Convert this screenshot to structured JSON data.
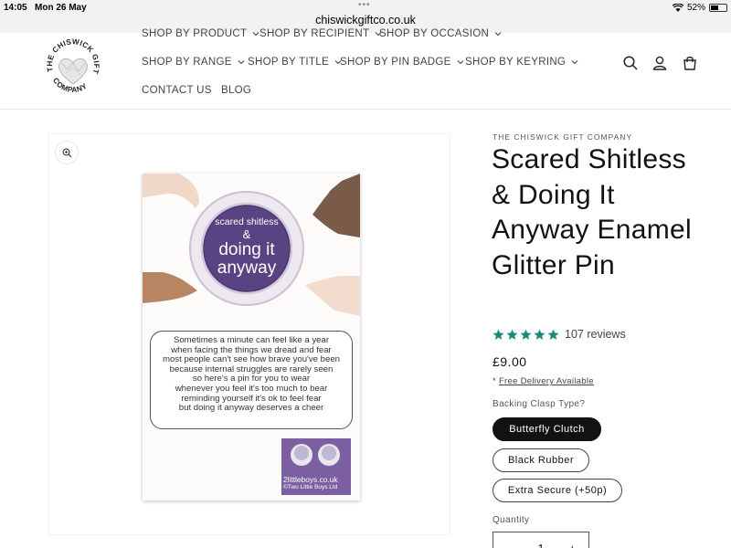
{
  "status_bar": {
    "time": "14:05",
    "date": "Mon 26 May",
    "dots": "•••",
    "url": "chiswickgiftco.co.uk",
    "battery": "52%",
    "battery_level": 0.52
  },
  "header": {
    "logo_text": "THE CHISWICK GIFT COMPANY",
    "nav": [
      {
        "label": "SHOP BY PRODUCT"
      },
      {
        "label": "SHOP BY RECIPIENT"
      },
      {
        "label": "SHOP BY OCCASION"
      },
      {
        "label": "SHOP BY RANGE"
      },
      {
        "label": "SHOP BY TITLE"
      },
      {
        "label": "SHOP BY PIN BADGE"
      },
      {
        "label": "SHOP BY KEYRING"
      },
      {
        "label": "CONTACT US"
      },
      {
        "label": "BLOG"
      }
    ],
    "icons": [
      "search-icon",
      "account-icon",
      "cart-icon"
    ]
  },
  "gallery": {
    "pin_text": {
      "top": "scared shitless",
      "amp": "&",
      "mid": "doing it",
      "bottom": "anyway"
    },
    "card_lines": [
      "Sometimes a minute can feel like a year",
      "when facing the things we dread and fear",
      "most people can't see how brave you've been",
      "because internal struggles are rarely seen",
      "so here's a pin for you to wear",
      "whenever you feel it's too much to bear",
      "reminding yourself it's ok to feel fear",
      "but doing it anyway deserves a cheer"
    ],
    "card_brand_1": "2littleboys.co.uk",
    "card_brand_2": "©Two Little Boys Ltd"
  },
  "product": {
    "vendor": "THE CHISWICK GIFT COMPANY",
    "title": "Scared Shitless & Doing It Anyway Enamel Glitter Pin",
    "rating": 5,
    "reviews": "107 reviews",
    "price": "£9.00",
    "shipping_prefix": "* ",
    "shipping_link": "Free Delivery Available",
    "option_label": "Backing Clasp Type?",
    "options": [
      {
        "label": "Butterfly Clutch",
        "selected": true
      },
      {
        "label": "Black Rubber",
        "selected": false
      },
      {
        "label": "Extra Secure (+50p)",
        "selected": false
      }
    ],
    "quantity_label": "Quantity",
    "quantity_value": "1",
    "minus": "−",
    "plus": "+"
  },
  "colors": {
    "accent_star": "#1c8a78",
    "button_dark": "#121212",
    "card_purple": "#7b5fa0"
  }
}
